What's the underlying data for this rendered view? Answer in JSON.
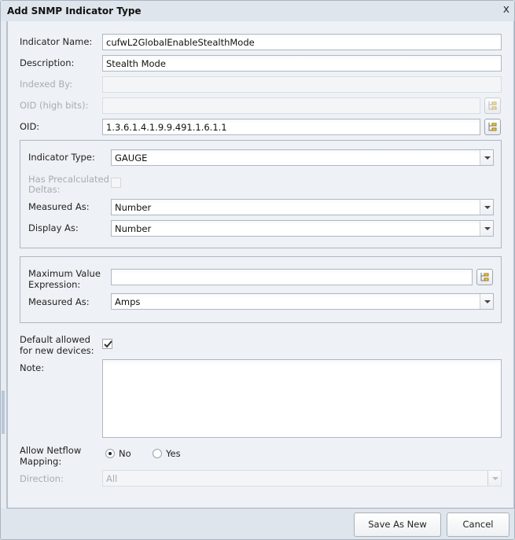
{
  "dialog": {
    "title": "Add SNMP Indicator Type",
    "close_glyph": "x"
  },
  "form": {
    "indicator_name": {
      "label": "Indicator Name:",
      "value": "cufwL2GlobalEnableStealthMode"
    },
    "description": {
      "label": "Description:",
      "value": "Stealth Mode"
    },
    "indexed_by": {
      "label": "Indexed By:",
      "value": "",
      "disabled": true
    },
    "oid_high_bits": {
      "label": "OID (high bits):",
      "value": "",
      "disabled": true
    },
    "oid": {
      "label": "OID:",
      "value": "1.3.6.1.4.1.9.9.491.1.6.1.1"
    },
    "type_group": {
      "indicator_type": {
        "label": "Indicator Type:",
        "value": "GAUGE"
      },
      "has_precalculated_deltas": {
        "label_line1": "Has Precalculated",
        "label_line2": "Deltas:",
        "checked": false,
        "disabled": true
      },
      "measured_as": {
        "label": "Measured As:",
        "value": "Number"
      },
      "display_as": {
        "label": "Display As:",
        "value": "Number"
      }
    },
    "max_group": {
      "max_value_expression": {
        "label_line1": "Maximum Value",
        "label_line2": "Expression:",
        "value": ""
      },
      "measured_as": {
        "label": "Measured As:",
        "value": "Amps"
      }
    },
    "default_allowed": {
      "label_line1": "Default allowed",
      "label_line2": "for new devices:",
      "checked": true
    },
    "note": {
      "label": "Note:",
      "value": ""
    },
    "allow_netflow": {
      "label_line1": "Allow Netflow",
      "label_line2": "Mapping:",
      "options": [
        {
          "label": "No",
          "selected": true
        },
        {
          "label": "Yes",
          "selected": false
        }
      ]
    },
    "direction": {
      "label": "Direction:",
      "value": "All",
      "disabled": true
    }
  },
  "footer": {
    "save_as_new": "Save As New",
    "cancel": "Cancel"
  },
  "icons": {
    "tree_picker": "tree-picker-icon",
    "dropdown": "chevron-down-icon",
    "check": "checkmark-icon",
    "close": "close-icon"
  }
}
